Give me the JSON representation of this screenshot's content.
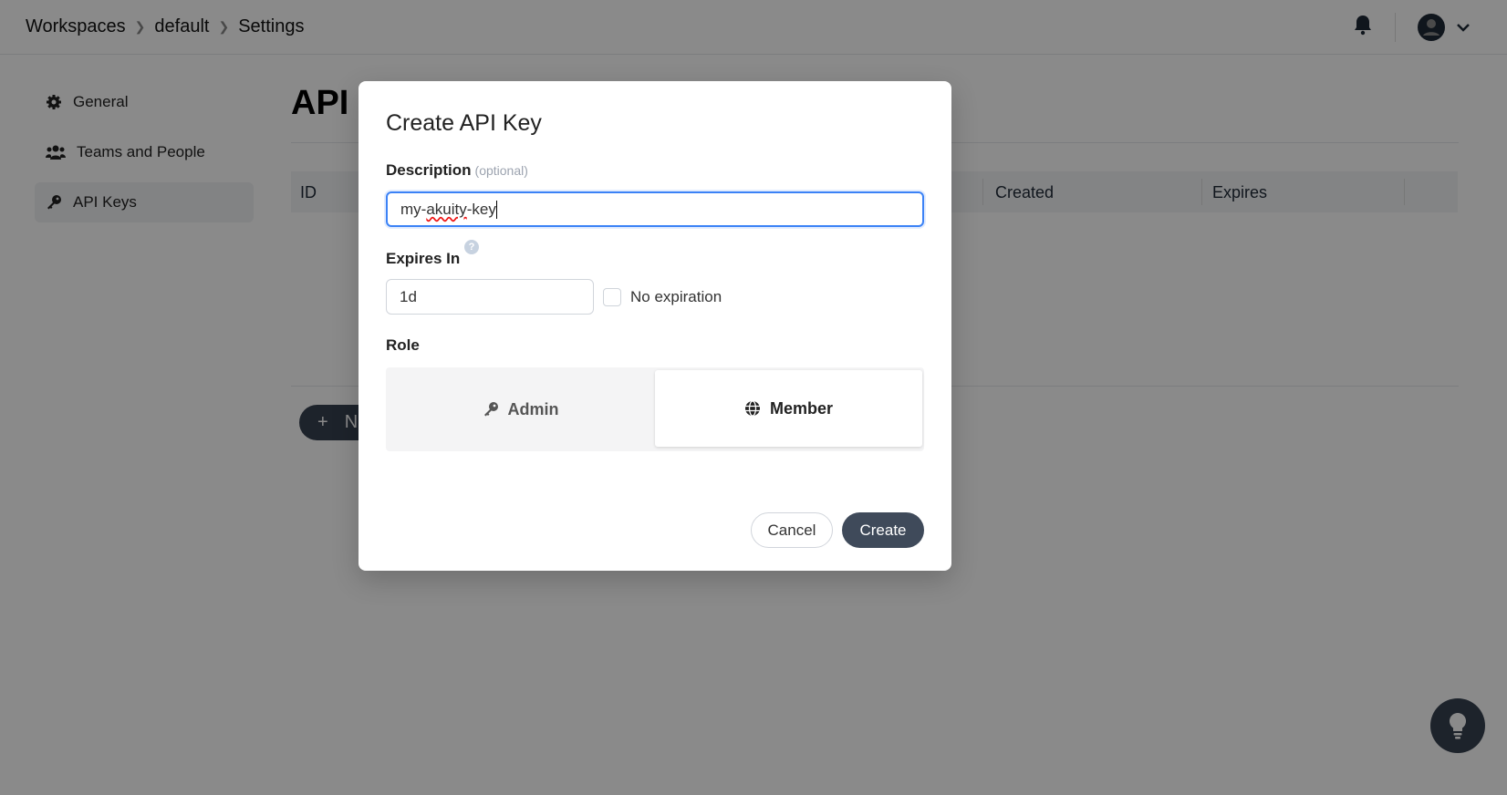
{
  "breadcrumb": [
    "Workspaces",
    "default",
    "Settings"
  ],
  "sidebar": {
    "items": [
      {
        "label": "General",
        "icon": "gear-icon"
      },
      {
        "label": "Teams and People",
        "icon": "users-icon"
      },
      {
        "label": "API Keys",
        "icon": "key-icon",
        "active": true
      }
    ]
  },
  "page": {
    "heading": "API",
    "table_headers": [
      "ID",
      "Created",
      "Expires"
    ],
    "new_button": "N"
  },
  "dialog": {
    "title": "Create API Key",
    "description_label": "Description",
    "description_optional": "(optional)",
    "description_value": "my-akuity-key",
    "expires_label": "Expires In",
    "help": "?",
    "expires_value": "1d",
    "no_expiration_label": "No expiration",
    "no_expiration_checked": false,
    "role_label": "Role",
    "roles": [
      {
        "label": "Admin",
        "icon": "key-icon",
        "selected": false
      },
      {
        "label": "Member",
        "icon": "globe-icon",
        "selected": true
      }
    ],
    "cancel": "Cancel",
    "create": "Create"
  },
  "colors": {
    "primary_button": "#3f4a5a",
    "focus": "#3b82f6"
  }
}
